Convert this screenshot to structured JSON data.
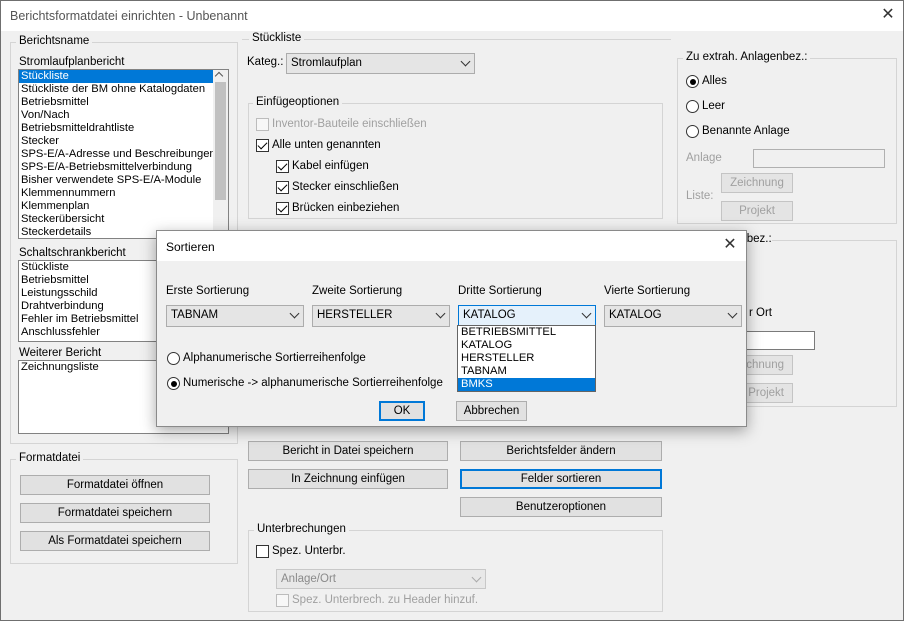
{
  "window": {
    "title": "Berichtsformatdatei einrichten - Unbenannt"
  },
  "berichtsname": {
    "legend": "Berichtsname",
    "strom_label": "Stromlaufplanbericht",
    "strom_items": [
      "Stückliste",
      "Stückliste der BM ohne Katalogdaten",
      "Betriebsmittel",
      "Von/Nach",
      "Betriebsmitteldrahtliste",
      "Stecker",
      "SPS-E/A-Adresse und Beschreibungen",
      "SPS-E/A-Betriebsmittelverbindung",
      "Bisher verwendete SPS-E/A-Module",
      "Klemmennummern",
      "Klemmenplan",
      "Steckerübersicht",
      "Steckerdetails"
    ],
    "schalt_label": "Schaltschrankbericht",
    "schalt_items": [
      "Stückliste",
      "Betriebsmittel",
      "Leistungsschild",
      "Drahtverbindung",
      "Fehler im Betriebsmittel",
      "Anschlussfehler"
    ],
    "weiterer_label": "Weiterer Bericht",
    "weiterer_items": [
      "Zeichnungsliste"
    ]
  },
  "formatdatei": {
    "legend": "Formatdatei",
    "open": "Formatdatei öffnen",
    "save": "Formatdatei speichern",
    "save_as": "Als Formatdatei speichern"
  },
  "stueckliste": {
    "legend": "Stückliste",
    "kateg_label": "Kateg.:",
    "kateg_value": "Stromlaufplan",
    "einfuege_legend": "Einfügeoptionen",
    "opt_inventor": "Inventor-Bauteile einschließen",
    "opt_alle": "Alle unten genannten",
    "opt_kabel": "Kabel einfügen",
    "opt_stecker": "Stecker einschließen",
    "opt_bruecken": "Brücken einbeziehen"
  },
  "anlagen": {
    "legend": "Zu extrah. Anlagenbez.:",
    "alles": "Alles",
    "leer": "Leer",
    "benannte": "Benannte Anlage",
    "anlage_label": "Anlage",
    "liste_label": "Liste:",
    "zeichnung": "Zeichnung",
    "projekt": "Projekt"
  },
  "ort": {
    "legend_partial": "sbez.:",
    "ort_partial": "r Ort",
    "zeichnung_partial": "chnung",
    "projekt_partial": "Projekt"
  },
  "actions": {
    "save_file": "Bericht in Datei speichern",
    "change_fields": "Berichtsfelder ändern",
    "insert_drawing": "In Zeichnung einfügen",
    "sort_fields": "Felder sortieren",
    "user_options": "Benutzeroptionen"
  },
  "unterbrechungen": {
    "legend": "Unterbrechungen",
    "spez": "Spez. Unterbr.",
    "combo": "Anlage/Ort",
    "header": "Spez. Unterbrech. zu Header hinzuf."
  },
  "sortieren": {
    "title": "Sortieren",
    "labels": [
      "Erste Sortierung",
      "Zweite Sortierung",
      "Dritte Sortierung",
      "Vierte Sortierung"
    ],
    "values": [
      "TABNAM",
      "HERSTELLER",
      "KATALOG",
      "KATALOG"
    ],
    "dropdown_options": [
      "BETRIEBSMITTEL",
      "KATALOG",
      "HERSTELLER",
      "TABNAM",
      "BMKS"
    ],
    "radio_alpha": "Alphanumerische Sortierreihenfolge",
    "radio_num": "Numerische -> alphanumerische Sortierreihenfolge",
    "ok": "OK",
    "cancel": "Abbrechen"
  }
}
